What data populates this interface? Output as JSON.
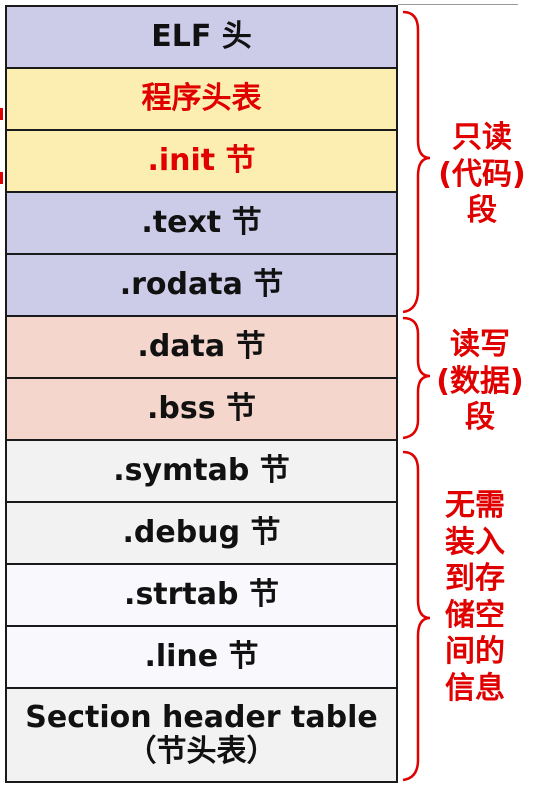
{
  "sections": [
    {
      "label": "ELF 头",
      "color": "#cccce9",
      "red": false
    },
    {
      "label": "程序头表",
      "color": "#fbeeb0",
      "red": true
    },
    {
      "label": ".init 节",
      "color": "#fbeeb0",
      "red": true
    },
    {
      "label": ".text 节",
      "color": "#cccce9",
      "red": false
    },
    {
      "label": ".rodata 节",
      "color": "#cccce9",
      "red": false
    },
    {
      "label": ".data 节",
      "color": "#f4d6cc",
      "red": false
    },
    {
      "label": ".bss 节",
      "color": "#f4d6cc",
      "red": false
    },
    {
      "label": ".symtab 节",
      "color": "#f2f2f2",
      "red": false
    },
    {
      "label": ".debug 节",
      "color": "#f2f2f2",
      "red": false
    },
    {
      "label": ".strtab 节",
      "color": "#f9f9fd",
      "red": false
    },
    {
      "label": ".line 节",
      "color": "#f9f9fd",
      "red": false
    },
    {
      "label": "Section header table",
      "label2": "（节头表）",
      "color": "#f2f2f2",
      "red": false
    }
  ],
  "groups": [
    {
      "lines": [
        "只读",
        "(代码)",
        "段"
      ]
    },
    {
      "lines": [
        "读写",
        "(数据)",
        "段"
      ]
    },
    {
      "lines": [
        "无需",
        "装入",
        "到存",
        "储空",
        "间的",
        "信息"
      ]
    }
  ],
  "colors": {
    "accent": "#e00000",
    "border": "#1a1a1a"
  }
}
